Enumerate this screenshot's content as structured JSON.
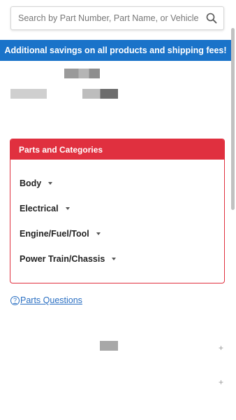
{
  "search": {
    "placeholder": "Search by Part Number, Part Name, or Vehicle",
    "icon": "search-icon"
  },
  "promo": {
    "text": "Additional savings on all products and shipping fees!",
    "color": "#1a73c9"
  },
  "parts_categories": {
    "title": "Parts and Categories",
    "accent_color": "#e0303f",
    "items": [
      {
        "label": "Body"
      },
      {
        "label": "Electrical"
      },
      {
        "label": "Engine/Fuel/Tool"
      },
      {
        "label": "Power Train/Chassis"
      }
    ]
  },
  "questions": {
    "label": "Parts Questions",
    "icon": "question-circle-icon"
  }
}
